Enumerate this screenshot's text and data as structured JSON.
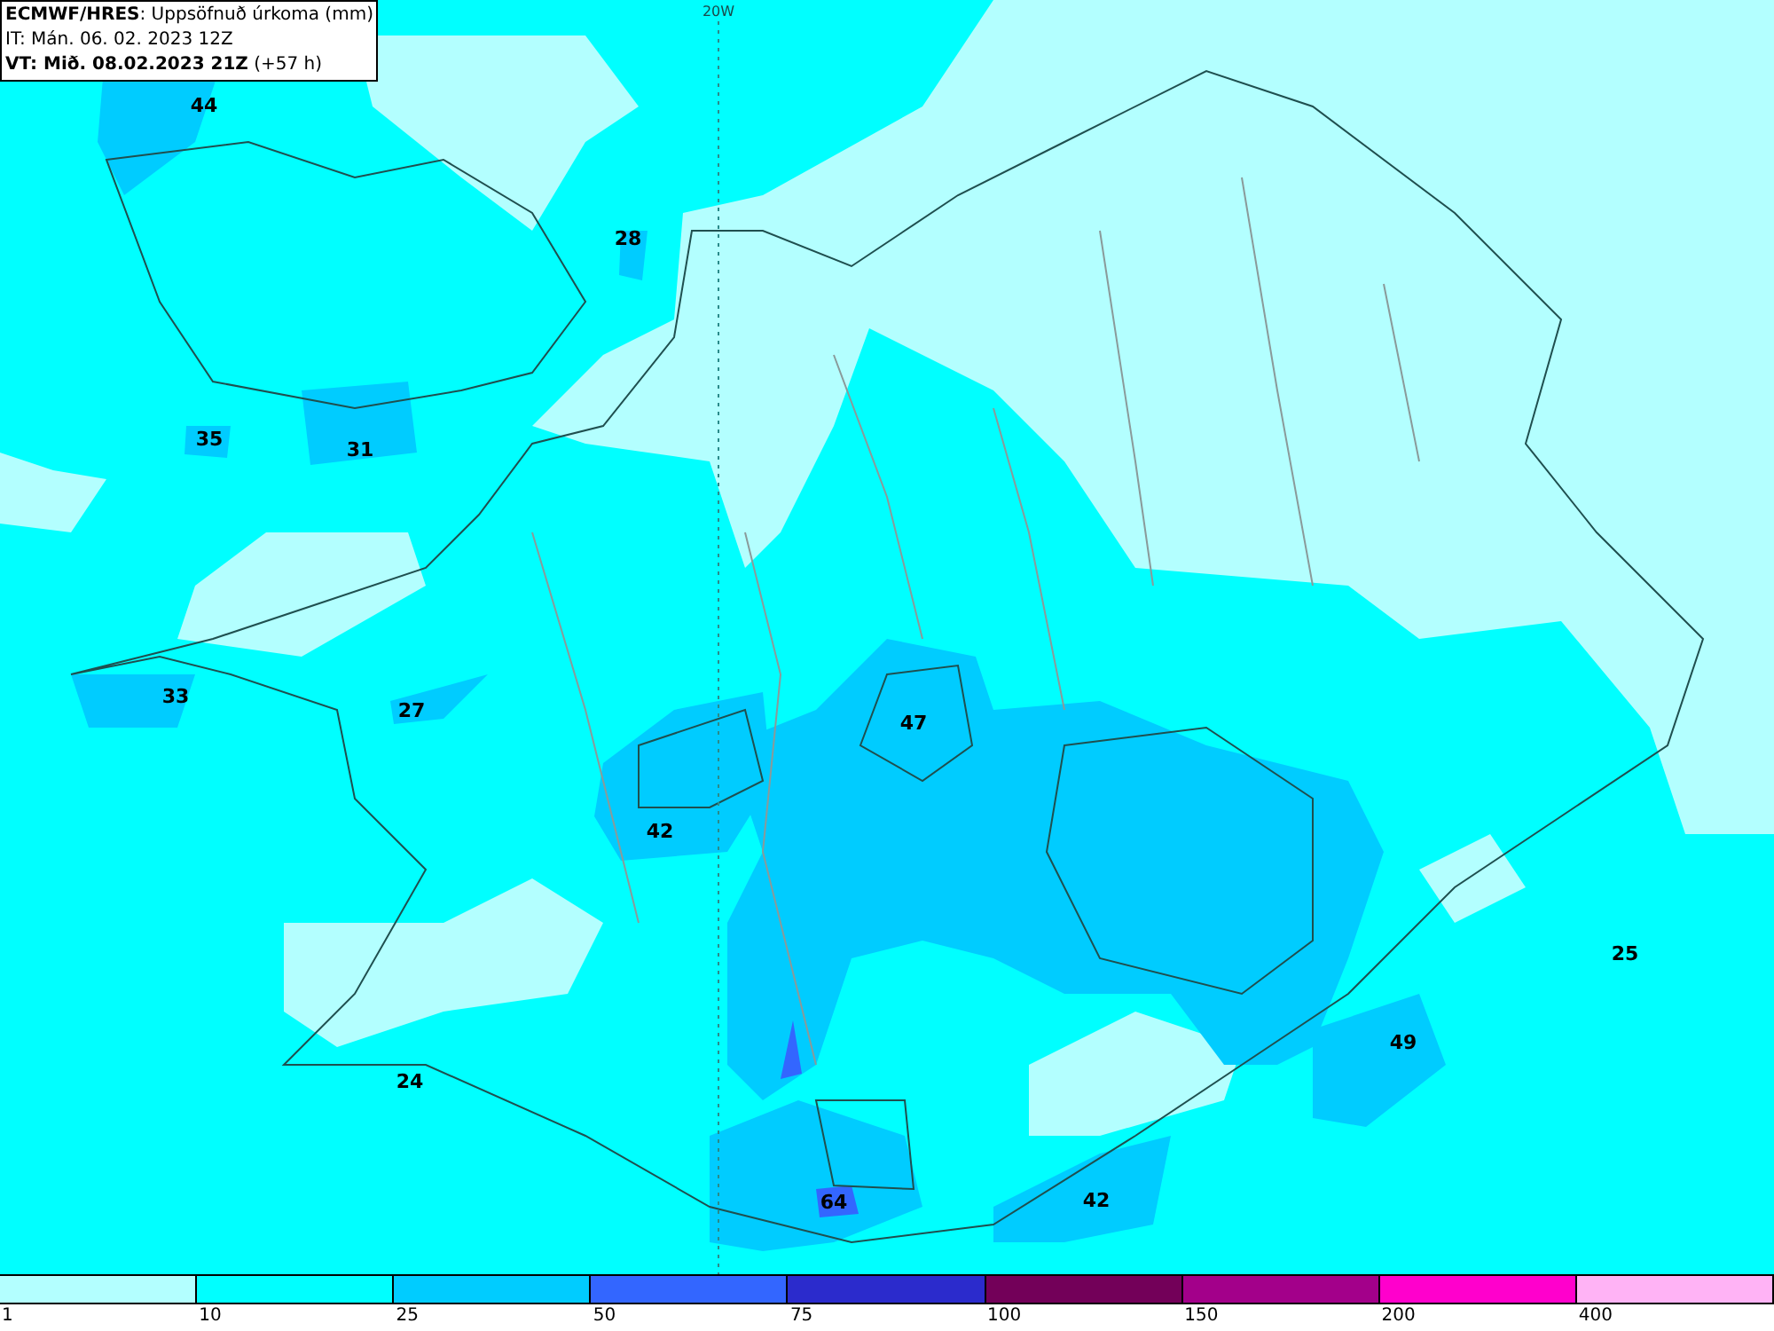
{
  "header": {
    "lines": [
      "**ECMWF/HRES**: Uppsöfnuð úrkoma (mm)",
      "IT: Mán. 06. 02. 2023 12Z",
      "**VT: Mið. 08.02.2023 21Z** (+57 h)"
    ]
  },
  "meridian": {
    "label": "20W"
  },
  "map_values": [
    "44",
    "28",
    "35",
    "31",
    "33",
    "27",
    "47",
    "42",
    "25",
    "49",
    "24",
    "64",
    "42"
  ],
  "legend": [
    {
      "label": "1",
      "color": "#b3ffff"
    },
    {
      "label": "10",
      "color": "#00ffff"
    },
    {
      "label": "25",
      "color": "#00ccff"
    },
    {
      "label": "50",
      "color": "#3366ff"
    },
    {
      "label": "75",
      "color": "#2b2bcc"
    },
    {
      "label": "100",
      "color": "#730059"
    },
    {
      "label": "150",
      "color": "#a3008a"
    },
    {
      "label": "200",
      "color": "#ff00cc"
    },
    {
      "label": "400",
      "color": "#ffb3f5"
    }
  ]
}
